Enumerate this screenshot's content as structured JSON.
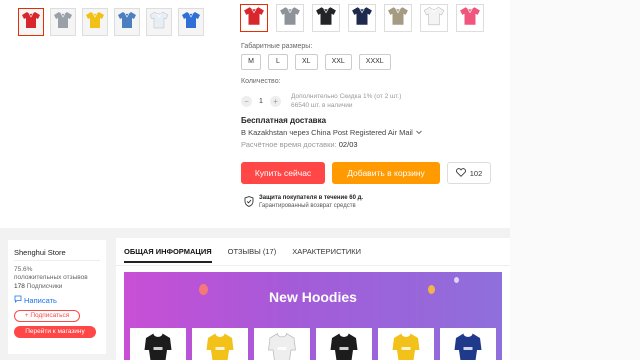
{
  "product": {
    "thumbnails": [
      {
        "icon": "polo-red-icon",
        "color": "#d9262c"
      },
      {
        "icon": "polo-gray-icon",
        "color": "#9aa0a8"
      },
      {
        "icon": "polo-yellow-icon",
        "color": "#f2c118"
      },
      {
        "icon": "polo-denim-icon",
        "color": "#4b7fbf"
      },
      {
        "icon": "polo-white-icon",
        "color": "#e8eef6"
      },
      {
        "icon": "polo-blue-icon",
        "color": "#2f6fd6"
      }
    ],
    "colors": [
      {
        "icon": "polo-red-icon",
        "color": "#d9262c"
      },
      {
        "icon": "polo-gray-icon",
        "color": "#8e9399"
      },
      {
        "icon": "polo-black-icon",
        "color": "#222428"
      },
      {
        "icon": "polo-navy-icon",
        "color": "#1d2a4d"
      },
      {
        "icon": "polo-khaki-icon",
        "color": "#a59a82"
      },
      {
        "icon": "polo-white-icon",
        "color": "#f4f4f4"
      },
      {
        "icon": "polo-pink-icon",
        "color": "#f0567c"
      }
    ],
    "size_label": "Габаритные размеры:",
    "sizes": [
      "M",
      "L",
      "XL",
      "XXL",
      "XXXL"
    ],
    "quantity_label": "Количество:",
    "quantity_minus": "−",
    "quantity_value": "1",
    "quantity_plus": "+",
    "discount_text": "Дополнительно Скидка 1% (от 2 шт.)",
    "stock_text": "66540 шт. в наличии",
    "shipping_title": "Бесплатная доставка",
    "shipping_dest": "В Kazakhstan через China Post Registered Air Mail",
    "shipping_time_label": "Расчётное время доставки:",
    "shipping_time_value": "02/03",
    "buy_label": "Купить сейчас",
    "cart_label": "Добавить в корзину",
    "wishlist_count": "102",
    "protection_title": "Защита покупателя в течение 60 д.",
    "protection_sub": "Гарантированный возврат средств"
  },
  "store": {
    "name": "Shenghui Store",
    "positive_pct": "75.6%",
    "positive_label": "положительных отзывов",
    "followers_count": "178",
    "followers_label": "Подписчики",
    "message_label": "Написать",
    "follow_label": "+ Подписаться",
    "visit_label": "Перейти к магазину"
  },
  "tabs": [
    "ОБЩАЯ ИНФОРМАЦИЯ",
    "ОТЗЫВЫ (17)",
    "ХАРАКТЕРИСТИКИ"
  ],
  "banner": {
    "title": "New Hoodies",
    "hoodies": [
      {
        "icon": "hoodie-black-icon",
        "color": "#1c1c1c"
      },
      {
        "icon": "hoodie-yellow-icon",
        "color": "#f3c21a"
      },
      {
        "icon": "hoodie-white-icon",
        "color": "#eeeeee"
      },
      {
        "icon": "hoodie-black-icon",
        "color": "#1c1c1c"
      },
      {
        "icon": "hoodie-yellow-icon",
        "color": "#f3c21a"
      },
      {
        "icon": "hoodie-navy-icon",
        "color": "#1f3a8a"
      }
    ]
  },
  "colors": {
    "accent_red": "#ff4747",
    "accent_orange": "#ff9a00",
    "banner_start": "#c84fd6",
    "banner_end": "#8f6fdc"
  }
}
